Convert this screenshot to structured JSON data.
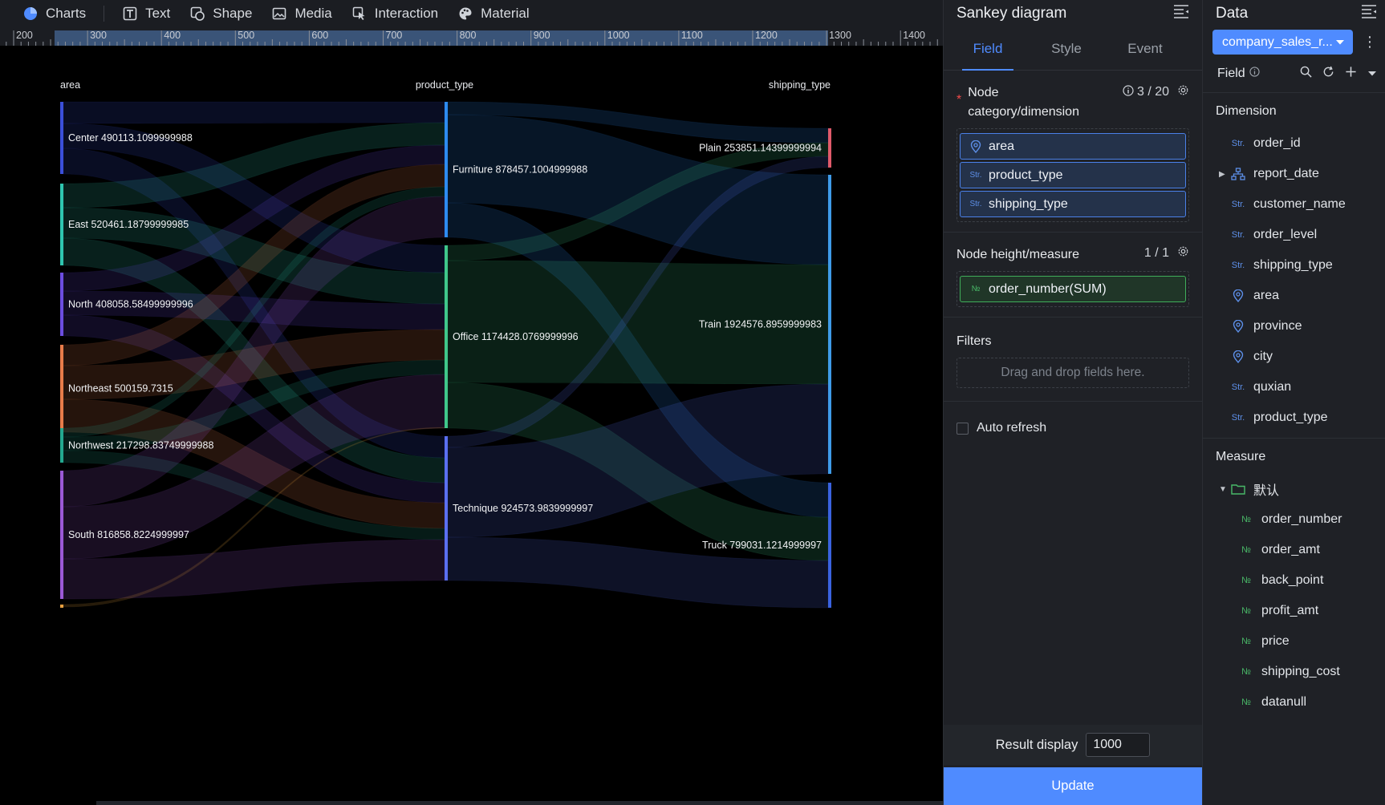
{
  "toolbar": {
    "items": [
      {
        "label": "Charts",
        "icon": "pie-chart-icon"
      },
      {
        "label": "Text",
        "icon": "text-icon"
      },
      {
        "label": "Shape",
        "icon": "shape-icon"
      },
      {
        "label": "Media",
        "icon": "image-icon"
      },
      {
        "label": "Interaction",
        "icon": "interaction-icon"
      },
      {
        "label": "Material",
        "icon": "palette-icon"
      }
    ]
  },
  "ruler": {
    "labels": [
      "200",
      "300",
      "400",
      "500",
      "600",
      "700",
      "800",
      "900",
      "1000",
      "1100",
      "1200",
      "1300",
      "1400"
    ]
  },
  "chart_data": {
    "type": "sankey",
    "columns": [
      "area",
      "product_type",
      "shipping_type"
    ],
    "nodes": [
      {
        "column": 0,
        "name": "Center",
        "value": "490113.1099999988",
        "color": "#3b4fd9"
      },
      {
        "column": 0,
        "name": "East",
        "value": "520461.18799999985",
        "color": "#2fc6b0"
      },
      {
        "column": 0,
        "name": "North",
        "value": "408058.58499999996",
        "color": "#6c4de0"
      },
      {
        "column": 0,
        "name": "Northeast",
        "value": "500159.7315",
        "color": "#e87c4a"
      },
      {
        "column": 0,
        "name": "Northwest",
        "value": "217298.83749999988",
        "color": "#23a88f"
      },
      {
        "column": 0,
        "name": "South",
        "value": "816858.8224999997",
        "color": "#9b59d6"
      },
      {
        "column": 0,
        "name": "",
        "value": "",
        "color": "#e8a040"
      },
      {
        "column": 1,
        "name": "Furniture",
        "value": "878457.1004999988",
        "color": "#2d8bf0"
      },
      {
        "column": 1,
        "name": "Office",
        "value": "1174428.0769999996",
        "color": "#3fc78a"
      },
      {
        "column": 1,
        "name": "Technique",
        "value": "924573.9839999997",
        "color": "#5a6ff0"
      },
      {
        "column": 2,
        "name": "Plain",
        "value": "253851.14399999994",
        "color": "#e05a6a"
      },
      {
        "column": 2,
        "name": "Train",
        "value": "1924576.8959999983",
        "color": "#3f9be8"
      },
      {
        "column": 2,
        "name": "Truck",
        "value": "799031.1214999997",
        "color": "#3a63e0"
      }
    ]
  },
  "panel": {
    "title": "Sankey diagram",
    "tabs": [
      "Field",
      "Style",
      "Event"
    ],
    "node_category": {
      "title": "Node category/dimension",
      "count": "3 / 20",
      "fields": [
        {
          "type": "geo",
          "label": "area"
        },
        {
          "type": "Str.",
          "label": "product_type"
        },
        {
          "type": "Str.",
          "label": "shipping_type"
        }
      ]
    },
    "node_height": {
      "title": "Node height/measure",
      "count": "1 / 1",
      "field": {
        "type": "№",
        "label": "order_number(SUM)"
      }
    },
    "filters": {
      "title": "Filters",
      "placeholder": "Drag and drop fields here."
    },
    "auto_refresh": "Auto refresh",
    "result_display": {
      "label": "Result display",
      "value": "1000"
    },
    "update": "Update"
  },
  "data_panel": {
    "title": "Data",
    "dataset": "company_sales_r...",
    "field_label": "Field",
    "dimension_title": "Dimension",
    "dimensions": [
      {
        "type": "Str.",
        "label": "order_id"
      },
      {
        "type": "hier",
        "label": "report_date"
      },
      {
        "type": "Str.",
        "label": "customer_name"
      },
      {
        "type": "Str.",
        "label": "order_level"
      },
      {
        "type": "Str.",
        "label": "shipping_type"
      },
      {
        "type": "geo",
        "label": "area"
      },
      {
        "type": "geo",
        "label": "province"
      },
      {
        "type": "geo",
        "label": "city"
      },
      {
        "type": "Str.",
        "label": "quxian"
      },
      {
        "type": "Str.",
        "label": "product_type"
      }
    ],
    "measure_title": "Measure",
    "measure_folder": "默认",
    "measures": [
      "order_number",
      "order_amt",
      "back_point",
      "profit_amt",
      "price",
      "shipping_cost",
      "datanull"
    ]
  },
  "colors": {
    "accent": "#4f8bff",
    "required": "#f04a4a",
    "measure": "#49b968"
  }
}
